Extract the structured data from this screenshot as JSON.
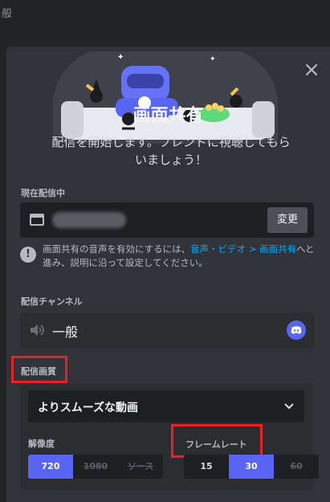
{
  "background": {
    "partial_text": "般"
  },
  "modal": {
    "title": "画面共有",
    "subtitle": "配信を開始します。フレンドに視聴してもらいましょう！",
    "close_icon": "close-icon",
    "current": {
      "label": "現在配信中",
      "change_button": "変更"
    },
    "info": {
      "text_before": "画面共有の音声を有効にするには、",
      "link": "音声・ビデオ > 画面共有",
      "text_after": "へと進み、説明に沿って設定してください。"
    },
    "channel": {
      "label": "配信チャンネル",
      "name": "一般"
    },
    "quality": {
      "label": "配信画質",
      "selected": "よりスムーズな動画",
      "resolution_label": "解像度",
      "resolution_options": [
        "720",
        "1080",
        "ソース"
      ],
      "framerate_label": "フレームレート",
      "framerate_options": [
        "15",
        "30",
        "60"
      ],
      "selected_resolution": "720",
      "selected_framerate": "30"
    }
  },
  "colors": {
    "accent": "#5865f2",
    "link": "#00a8fc",
    "highlight": "#e82127",
    "panel": "#313338"
  }
}
